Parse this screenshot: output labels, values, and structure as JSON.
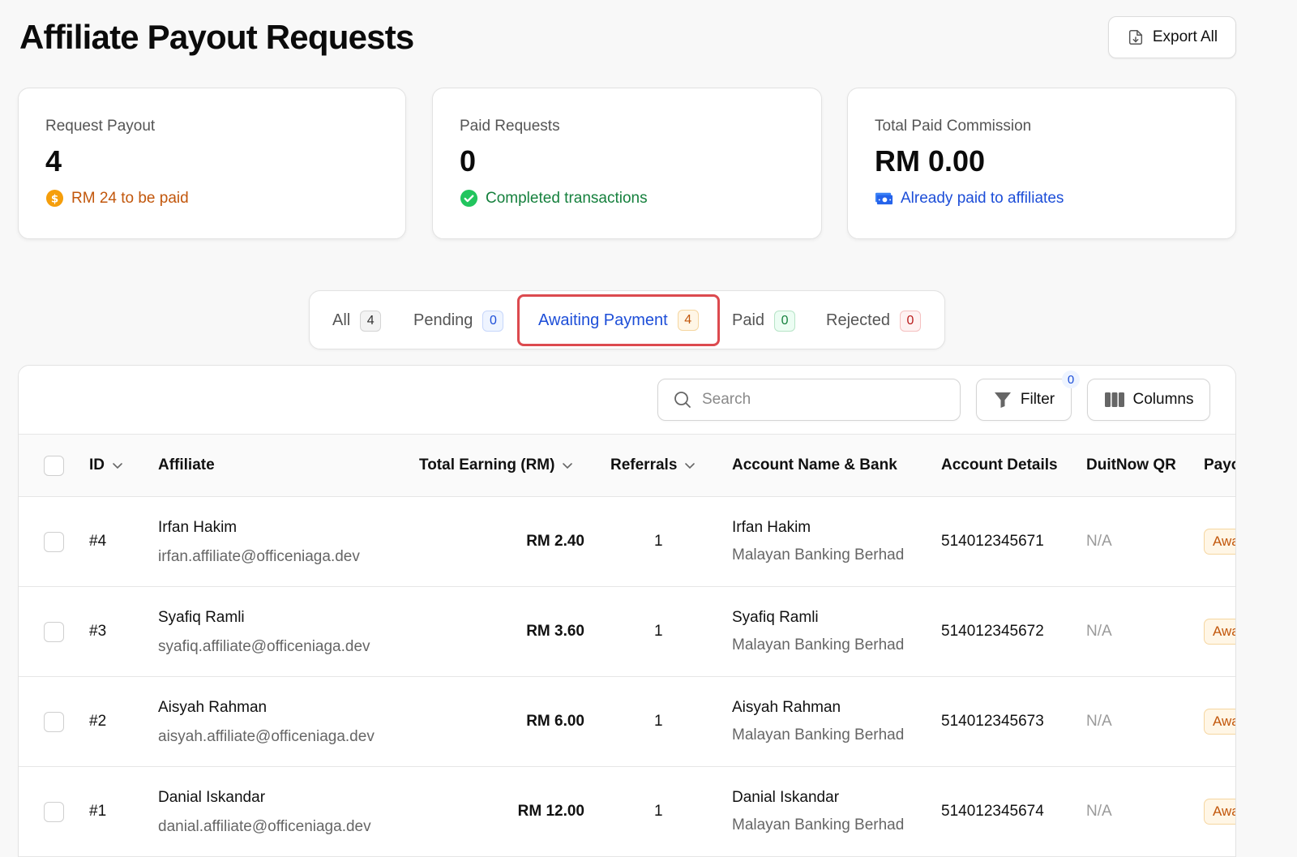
{
  "page": {
    "title": "Affiliate Payout Requests",
    "export_label": "Export All"
  },
  "cards": [
    {
      "label": "Request Payout",
      "value": "4",
      "sub": "RM 24 to be paid",
      "icon": "dollar-coin-icon",
      "color": "#c2570c"
    },
    {
      "label": "Paid Requests",
      "value": "0",
      "sub": "Completed transactions",
      "icon": "check-circle-icon",
      "color": "#15803d"
    },
    {
      "label": "Total Paid Commission",
      "value": "RM 0.00",
      "sub": "Already paid to affiliates",
      "icon": "banknote-icon",
      "color": "#1d4ed8"
    }
  ],
  "tabs": [
    {
      "label": "All",
      "count": "4"
    },
    {
      "label": "Pending",
      "count": "0"
    },
    {
      "label": "Awaiting Payment",
      "count": "4",
      "active": true
    },
    {
      "label": "Paid",
      "count": "0"
    },
    {
      "label": "Rejected",
      "count": "0"
    }
  ],
  "toolbar": {
    "search_placeholder": "Search",
    "filter_label": "Filter",
    "filter_count": "0",
    "columns_label": "Columns"
  },
  "table": {
    "headers": [
      "ID",
      "Affiliate",
      "Total Earning (RM)",
      "Referrals",
      "Account Name & Bank",
      "Account Details",
      "DuitNow QR",
      "Payo"
    ],
    "rows": [
      {
        "id": "#4",
        "name": "Irfan Hakim",
        "email": "irfan.affiliate@officeniaga.dev",
        "earning": "RM 2.40",
        "referrals": "1",
        "account_name": "Irfan Hakim",
        "bank": "Malayan Banking Berhad",
        "account_no": "514012345671",
        "qr": "N/A",
        "status": "Awa"
      },
      {
        "id": "#3",
        "name": "Syafiq Ramli",
        "email": "syafiq.affiliate@officeniaga.dev",
        "earning": "RM 3.60",
        "referrals": "1",
        "account_name": "Syafiq Ramli",
        "bank": "Malayan Banking Berhad",
        "account_no": "514012345672",
        "qr": "N/A",
        "status": "Awa"
      },
      {
        "id": "#2",
        "name": "Aisyah Rahman",
        "email": "aisyah.affiliate@officeniaga.dev",
        "earning": "RM 6.00",
        "referrals": "1",
        "account_name": "Aisyah Rahman",
        "bank": "Malayan Banking Berhad",
        "account_no": "514012345673",
        "qr": "N/A",
        "status": "Awa"
      },
      {
        "id": "#1",
        "name": "Danial Iskandar",
        "email": "danial.affiliate@officeniaga.dev",
        "earning": "RM 12.00",
        "referrals": "1",
        "account_name": "Danial Iskandar",
        "bank": "Malayan Banking Berhad",
        "account_no": "514012345674",
        "qr": "N/A",
        "status": "Awa"
      }
    ]
  }
}
